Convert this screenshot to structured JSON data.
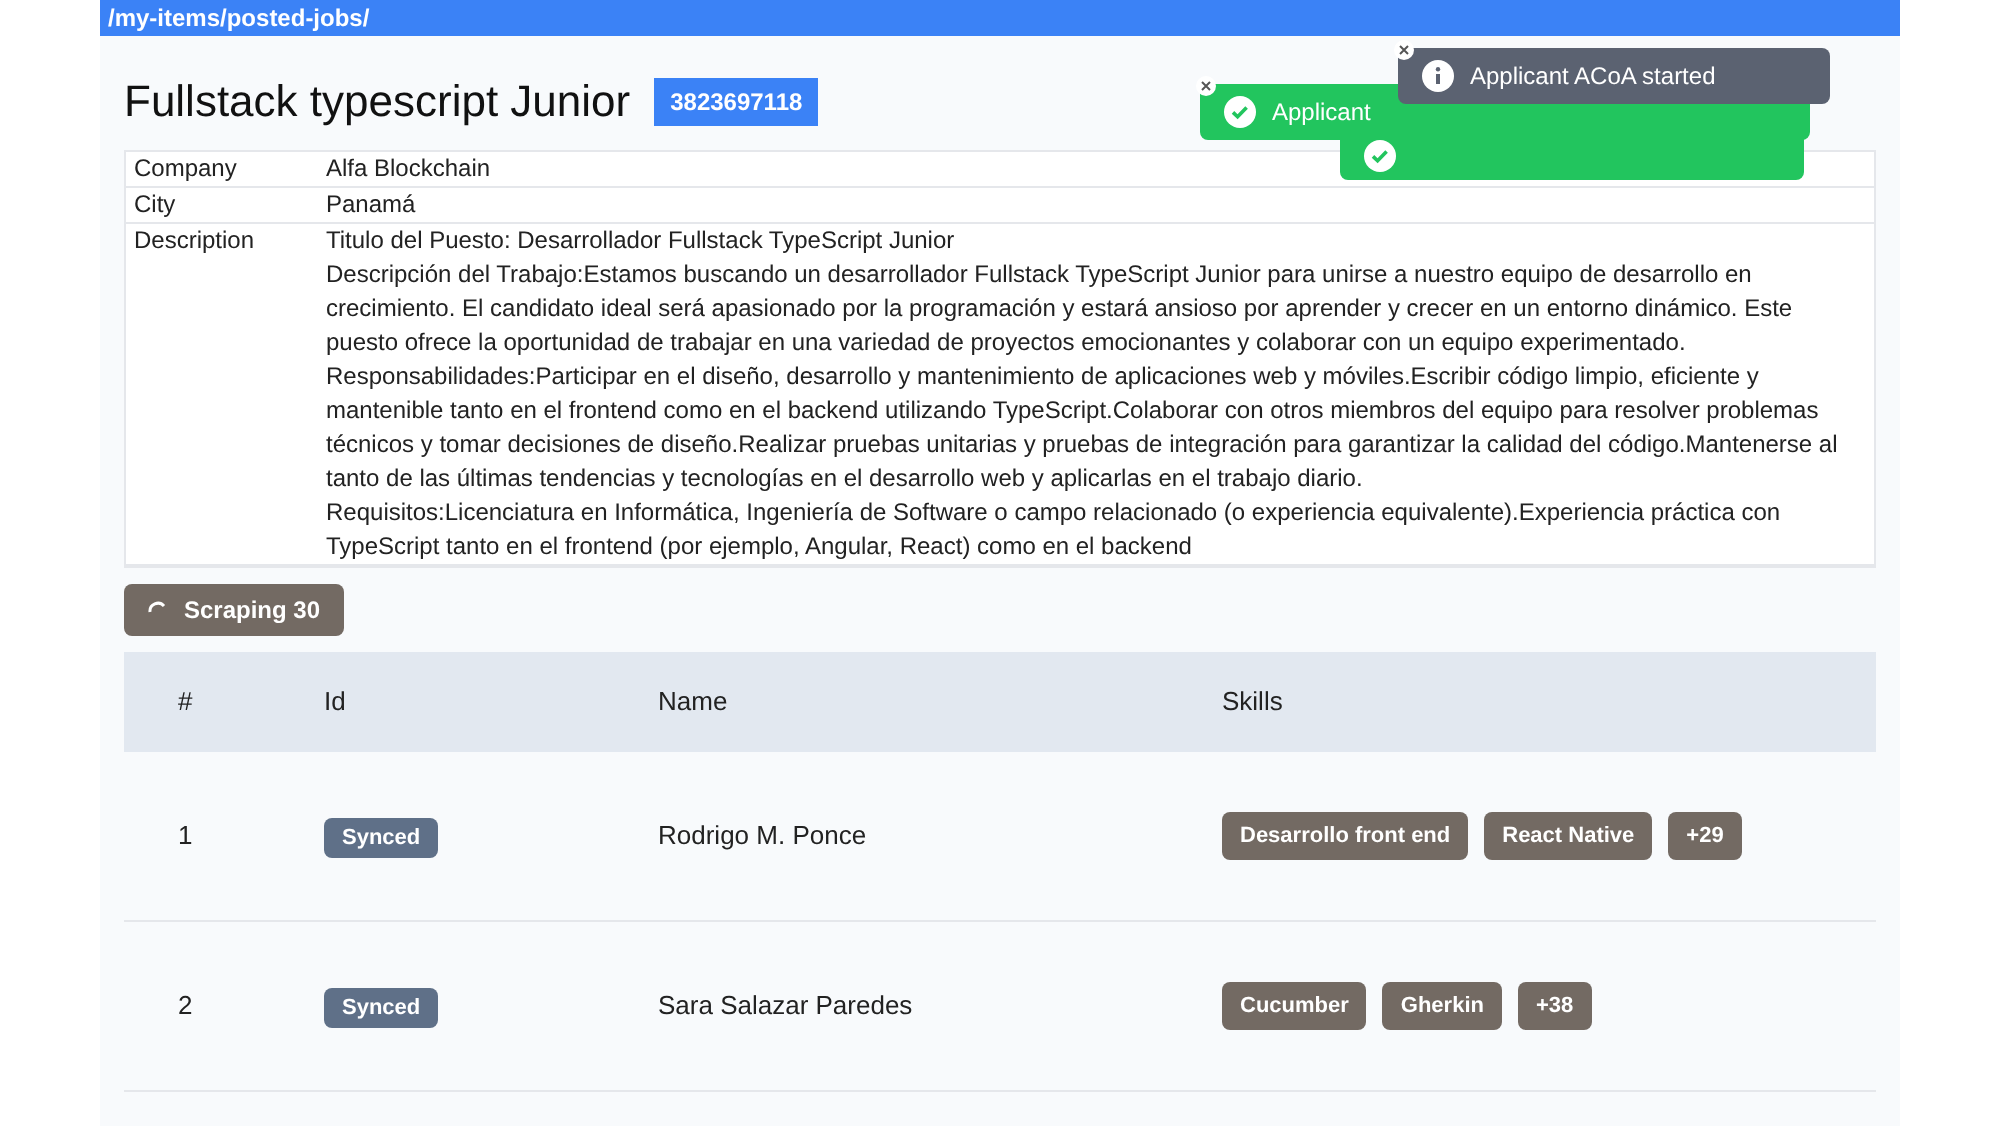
{
  "address_bar": {
    "path": "/my-items/posted-jobs/"
  },
  "job": {
    "title": "Fullstack typescript Junior",
    "id": "3823697118"
  },
  "details": [
    {
      "label": "Company",
      "value": [
        "Alfa Blockchain"
      ]
    },
    {
      "label": "City",
      "value": [
        "Panamá"
      ]
    },
    {
      "label": "Description",
      "value": [
        "Titulo del Puesto: Desarrollador Fullstack TypeScript Junior",
        "Descripción del Trabajo:Estamos buscando un desarrollador Fullstack TypeScript Junior para unirse a nuestro equipo de desarrollo en crecimiento. El candidato ideal será apasionado por la programación y estará ansioso por aprender y crecer en un entorno dinámico. Este puesto ofrece la oportunidad de trabajar en una variedad de proyectos emocionantes y colaborar con un equipo experimentado.",
        "Responsabilidades:Participar en el diseño, desarrollo y mantenimiento de aplicaciones web y móviles.Escribir código limpio, eficiente y mantenible tanto en el frontend como en el backend utilizando TypeScript.Colaborar con otros miembros del equipo para resolver problemas técnicos y tomar decisiones de diseño.Realizar pruebas unitarias y pruebas de integración para garantizar la calidad del código.Mantenerse al tanto de las últimas tendencias y tecnologías en el desarrollo web y aplicarlas en el trabajo diario.",
        "Requisitos:Licenciatura en Informática, Ingeniería de Software o campo relacionado (o experiencia equivalente).Experiencia práctica con TypeScript tanto en el frontend (por ejemplo, Angular, React) como en el backend"
      ]
    }
  ],
  "scrape_button": {
    "label": "Scraping 30",
    "loading": true
  },
  "table": {
    "columns": [
      "#",
      "Id",
      "Name",
      "Skills"
    ],
    "rows": [
      {
        "number": "1",
        "status": "Synced",
        "name": "Rodrigo M. Ponce",
        "skills": [
          "Desarrollo front end",
          "React Native",
          "+29"
        ]
      },
      {
        "number": "2",
        "status": "Synced",
        "name": "Sara Salazar Paredes",
        "skills": [
          "Cucumber",
          "Gherkin",
          "+38"
        ]
      }
    ]
  },
  "toasts": [
    {
      "kind": "success",
      "text": "Applicant"
    },
    {
      "kind": "success"
    },
    {
      "kind": "info",
      "text": "Applicant ACoA started"
    }
  ]
}
